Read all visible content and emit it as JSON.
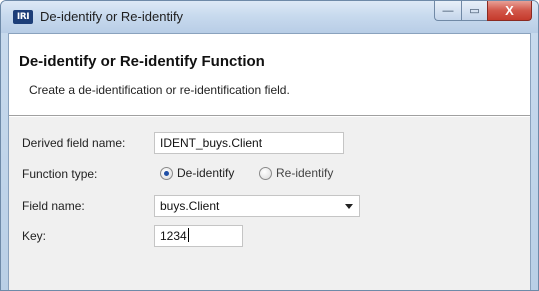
{
  "window": {
    "title": "De-identify or Re-identify",
    "app_icon_text": "IRI",
    "controls": {
      "minimize": "—",
      "maximize": "▭",
      "close": "X"
    }
  },
  "header": {
    "title": "De-identify or Re-identify Function",
    "description": "Create a de-identification or re-identification field."
  },
  "form": {
    "derived_field_name": {
      "label": "Derived field name:",
      "value": "IDENT_buys.Client"
    },
    "function_type": {
      "label": "Function type:",
      "options": [
        {
          "label": "De-identify",
          "selected": true
        },
        {
          "label": "Re-identify",
          "selected": false
        }
      ]
    },
    "field_name": {
      "label": "Field name:",
      "value": "buys.Client"
    },
    "key": {
      "label": "Key:",
      "value": "1234"
    }
  }
}
